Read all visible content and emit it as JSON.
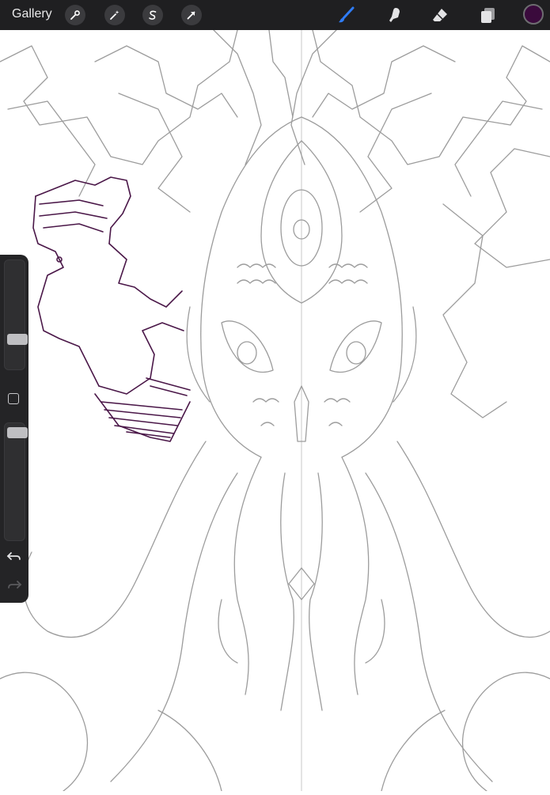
{
  "topbar": {
    "gallery_label": "Gallery",
    "left_tools": [
      {
        "name": "actions",
        "icon": "wrench-icon"
      },
      {
        "name": "adjustments",
        "icon": "magic-wand-icon"
      },
      {
        "name": "selection",
        "icon": "selection-s-icon"
      },
      {
        "name": "transform",
        "icon": "arrow-cursor-icon"
      }
    ],
    "right_tools": [
      {
        "name": "brush",
        "icon": "brush-icon",
        "active": true,
        "color": "#2f7cf6"
      },
      {
        "name": "smudge",
        "icon": "smudge-finger-icon"
      },
      {
        "name": "eraser",
        "icon": "eraser-icon"
      },
      {
        "name": "layers",
        "icon": "layers-icon"
      }
    ],
    "current_color": "#3a0a3c"
  },
  "sidebar": {
    "brush_size_level": 0.25,
    "opacity_level": 0.04,
    "undo_icon": "undo-icon",
    "redo_icon": "redo-icon",
    "modify_icon": "modify-square-icon"
  },
  "canvas": {
    "sketch_stroke_color": "#9c9c9c",
    "ink_stroke_color": "#4a1748"
  }
}
